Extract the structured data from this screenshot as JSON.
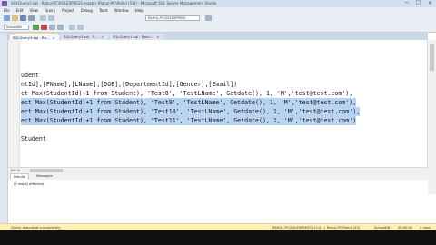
{
  "window": {
    "title": "SQLQuery3.sql - Rahul-PC\\SQLEXPRESS.master (Rahul-PC\\Rahul (53)) - Microsoft SQL Server Management Studio",
    "min_label": "─",
    "max_label": "☐",
    "close_label": "✕"
  },
  "menu": {
    "items": [
      "File",
      "Edit",
      "View",
      "Query",
      "Project",
      "Debug",
      "Tools",
      "Window",
      "Help"
    ]
  },
  "toolbar": {
    "server_combo": "RAHUL-PC\\SQLEXPRESS",
    "db_combo": "SchoolDB"
  },
  "tabs": [
    {
      "label": "SQLQuery3.sql - Ra...",
      "close": "×"
    },
    {
      "label": "SQLQuery2.sql - R...",
      "close": "×"
    },
    {
      "label": "SQLQuery1.sql - Rahu...",
      "close": "×"
    }
  ],
  "editor": {
    "lines": [
      {
        "text": "udent",
        "selected": false
      },
      {
        "text": "ntId],[FName],[LName],[DOB],[DepartmentId],[Gender],[Email])",
        "selected": false
      },
      {
        "text": "ct Max(StudentId)+1 from Student), 'Test8', 'TestLName', Getdate(), 1, 'M','test@test.com'),",
        "selected": false
      },
      {
        "text": "ect Max(StudentId)+1 from Student), 'Test9', 'TestLName', Getdate(), 1, 'M','test@test.com'),",
        "selected": true
      },
      {
        "text": "ect Max(StudentId)+1 from Student), 'Test10', 'TestLName', Getdate(), 1, 'M','test@test.com'),",
        "selected": true
      },
      {
        "text": "ect Max(StudentId)+1 from Student), 'Test11', 'TestLName', Getdate(), 1, 'M','test@test.com')",
        "selected": true
      },
      {
        "text": "Student",
        "selected": false
      }
    ]
  },
  "zoom": {
    "label": "100 %"
  },
  "results": {
    "tabs": [
      "Results",
      "Messages"
    ],
    "message": "(4 row(s) affected)"
  },
  "status": {
    "left": "Query executed successfully.",
    "server": "RAHUL-PC\\SQLEXPRESS (12.0...)",
    "user": "Rahul-PC\\Rahul (53)",
    "db": "SchoolDB",
    "time": "00:00:00",
    "rows": "0 rows"
  },
  "colors": {
    "selection": "#b9d3f2",
    "status_bar": "#fdf0b8",
    "active_tab_accent": "#e8a94a"
  }
}
